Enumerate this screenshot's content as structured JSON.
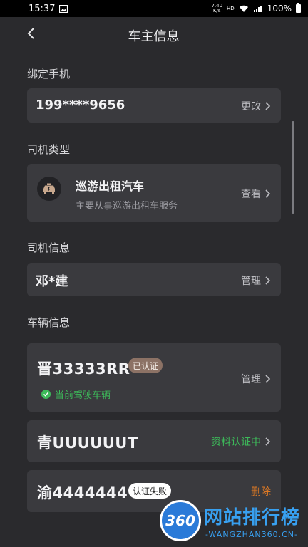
{
  "status_bar": {
    "time": "15:37",
    "net_speed_value": "7.40",
    "net_speed_unit": "K/s",
    "hd": "HD",
    "battery": "100%"
  },
  "header": {
    "title": "车主信息"
  },
  "phone": {
    "label": "绑定手机",
    "number": "199****9656",
    "action": "更改"
  },
  "driver_type": {
    "label": "司机类型",
    "title": "巡游出租汽车",
    "subtitle": "主要从事巡游出租车服务",
    "action": "查看",
    "icon": "taxi-icon"
  },
  "driver_info": {
    "label": "司机信息",
    "name": "邓*建",
    "action": "管理"
  },
  "vehicles": {
    "label": "车辆信息",
    "items": [
      {
        "plate": "晋33333RR",
        "badge": "已认证",
        "current": "当前驾驶车辆",
        "action": "管理"
      },
      {
        "plate": "青UUUUUUT",
        "status": "资料认证中"
      },
      {
        "plate": "渝4444444",
        "badge": "认证失败",
        "action": "删除"
      }
    ]
  },
  "watermark": {
    "logo_number": "360",
    "site_name": "网站排行榜",
    "domain": "-WANGZHAN360.CN-"
  },
  "colors": {
    "background": "#2a2a2d",
    "card": "#3a3a3e",
    "green": "#3dbb5a",
    "orange": "#e07a24",
    "verified_badge": "#8c7265"
  }
}
